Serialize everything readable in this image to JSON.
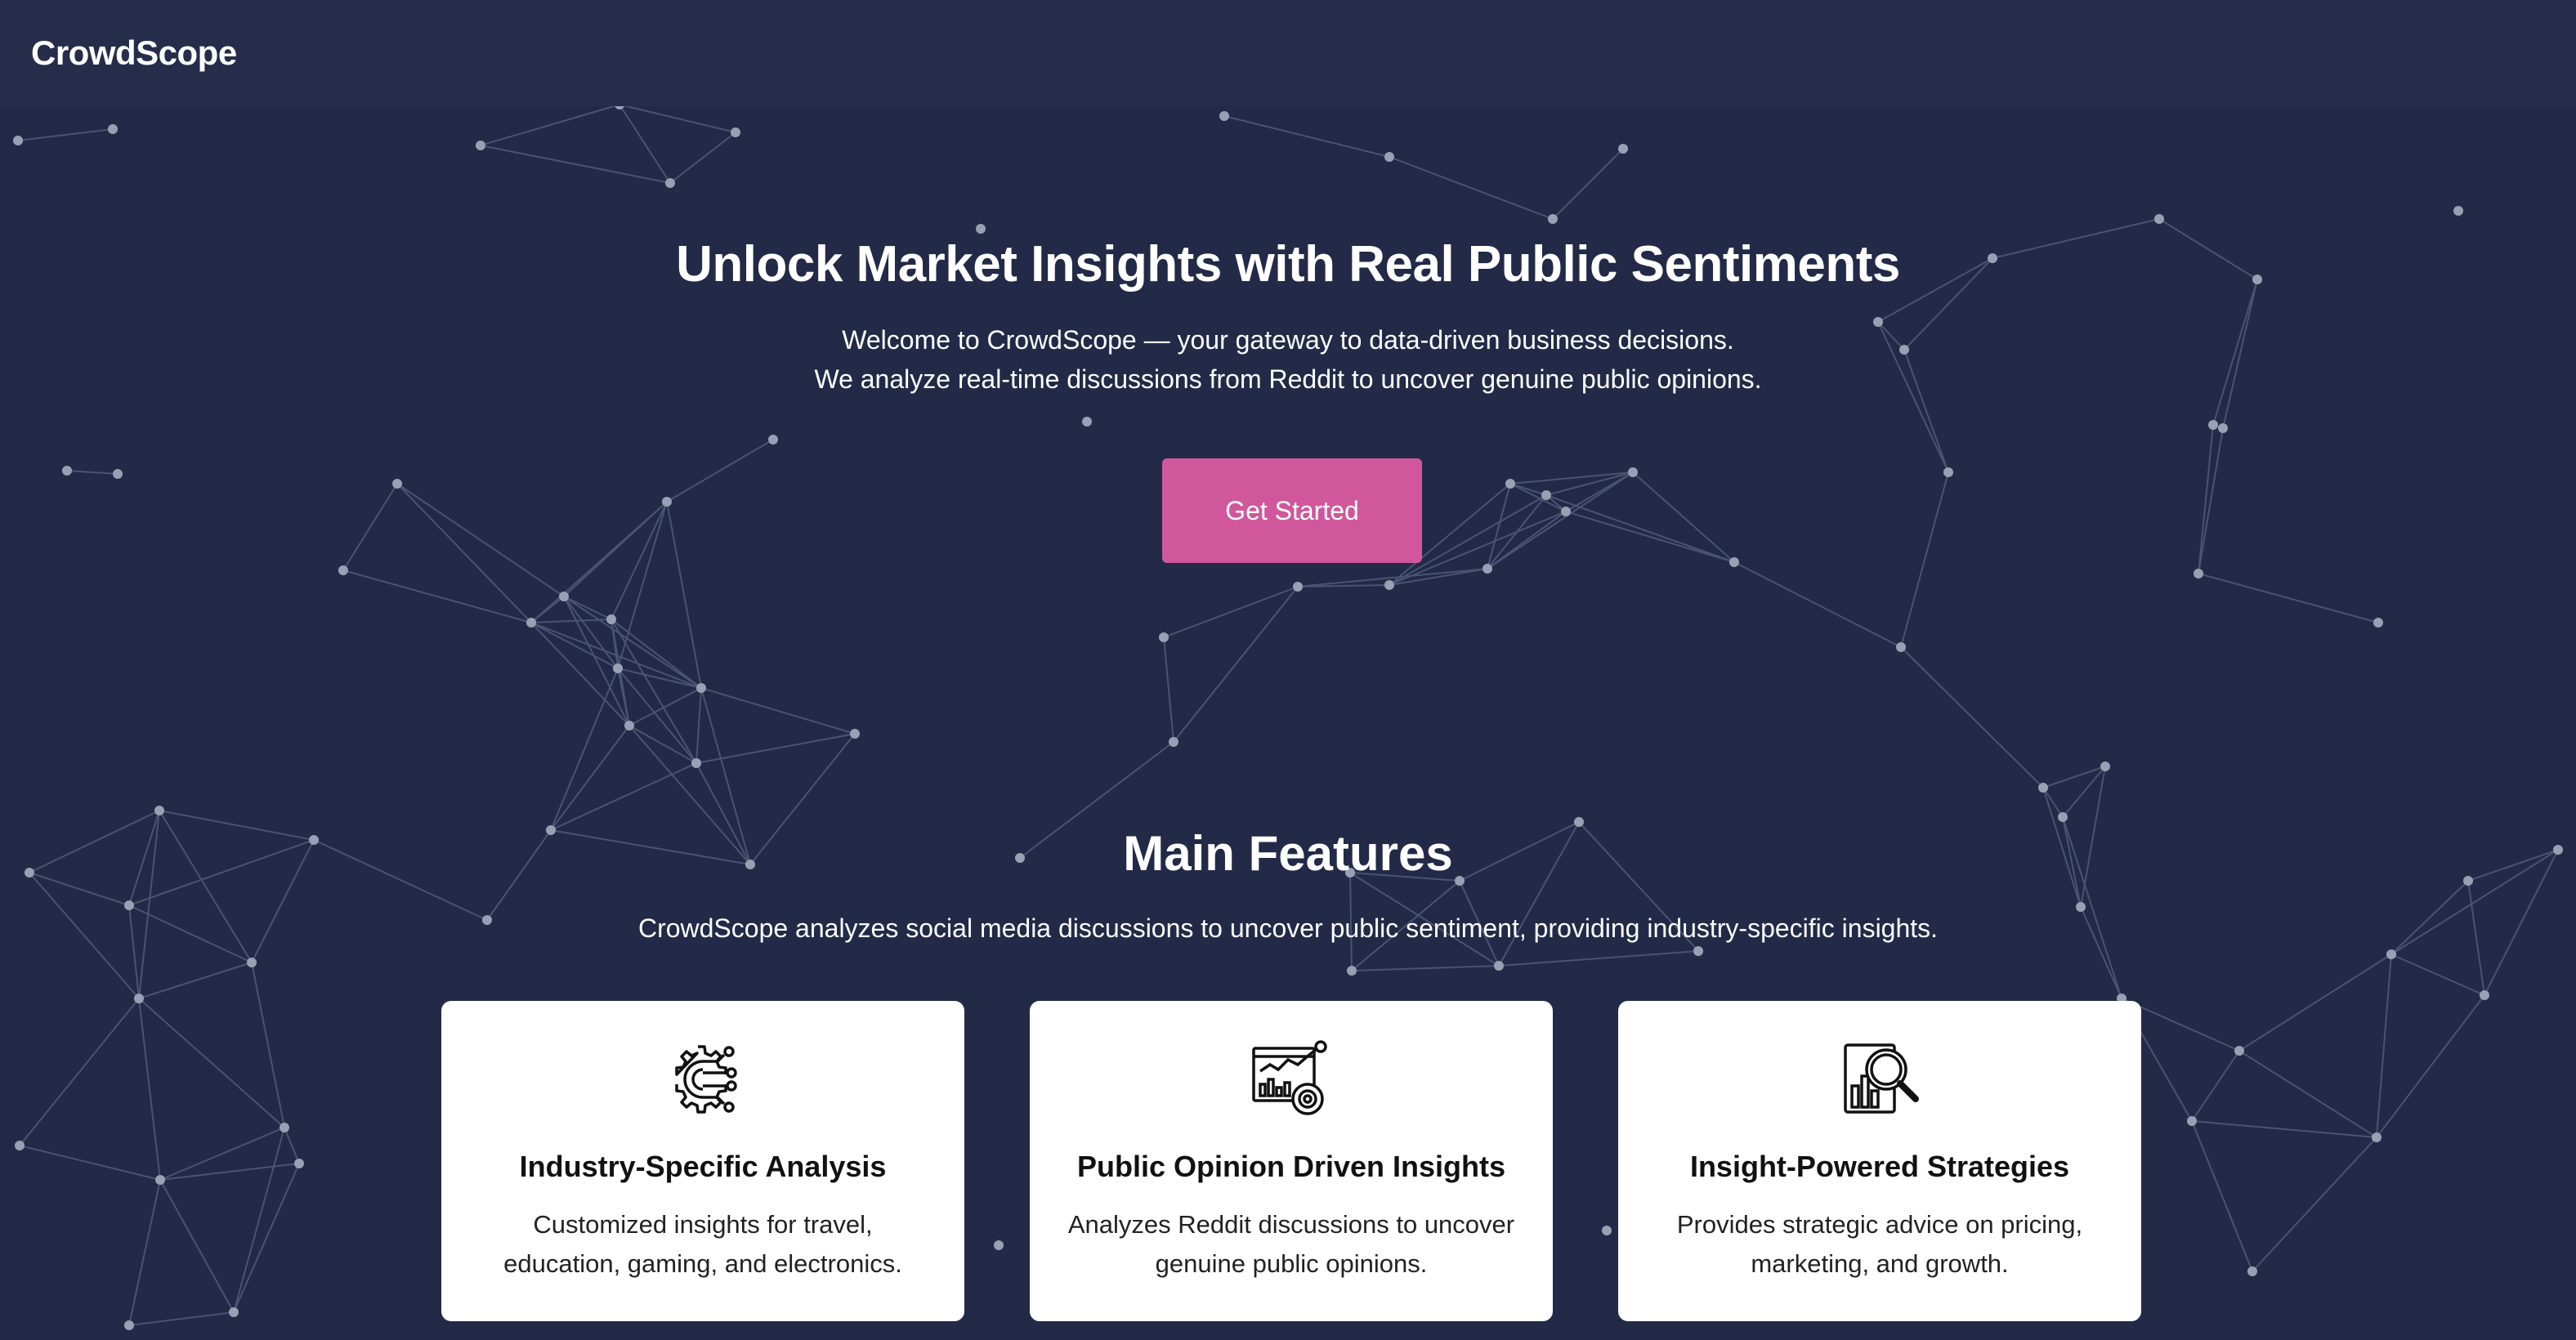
{
  "navbar": {
    "brand": "CrowdScope"
  },
  "hero": {
    "title": "Unlock Market Insights with Real Public Sentiments",
    "line1": "Welcome to CrowdScope — your gateway to data-driven business decisions.",
    "line2": "We analyze real-time discussions from Reddit to uncover genuine public opinions.",
    "cta_label": "Get Started"
  },
  "features": {
    "title": "Main Features",
    "subtitle": "CrowdScope analyzes social media discussions to uncover public sentiment, providing industry-specific insights.",
    "cards": [
      {
        "icon": "gear-circuit-icon",
        "title": "Industry-Specific Analysis",
        "description": "Customized insights for travel, education, gaming, and electronics."
      },
      {
        "icon": "analytics-dashboard-icon",
        "title": "Public Opinion Driven Insights",
        "description": "Analyzes Reddit discussions to uncover genuine public opinions."
      },
      {
        "icon": "magnifier-chart-icon",
        "title": "Insight-Powered Strategies",
        "description": "Provides strategic advice on pricing, marketing, and growth."
      }
    ]
  },
  "colors": {
    "background": "#222a48",
    "navbar": "#252d4b",
    "accent": "#d0579c",
    "card": "#ffffff",
    "network_node": "#9aa0b4"
  }
}
